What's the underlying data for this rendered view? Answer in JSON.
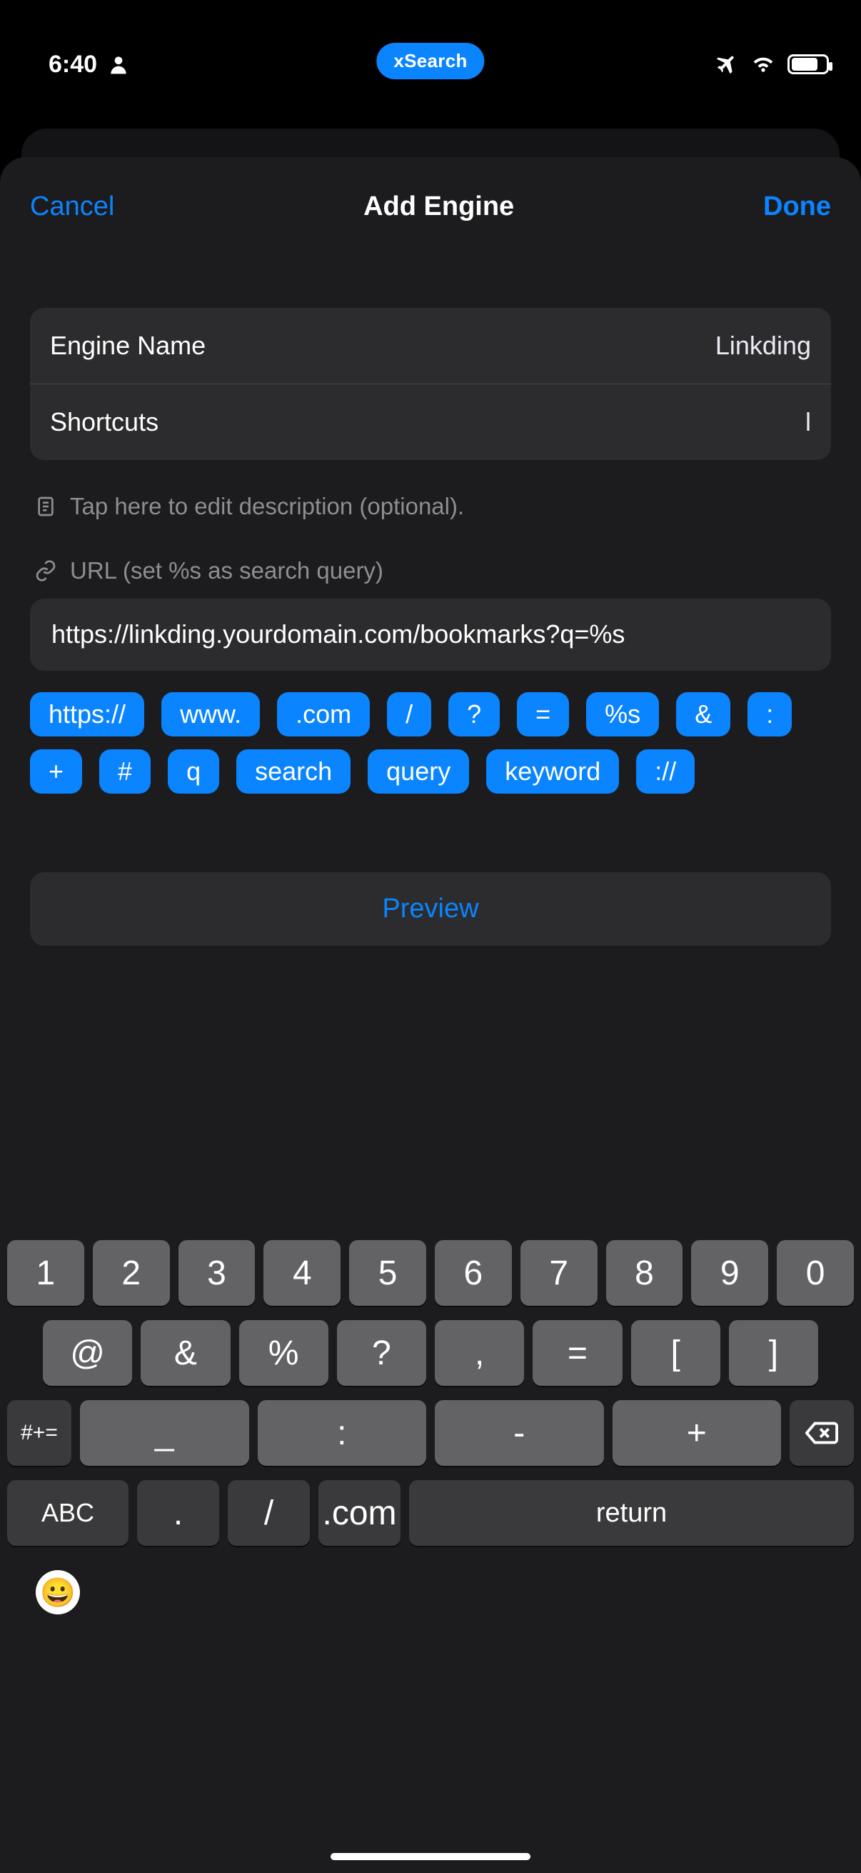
{
  "status": {
    "time": "6:40"
  },
  "pill": {
    "label": "xSearch"
  },
  "nav": {
    "cancel": "Cancel",
    "title": "Add Engine",
    "done": "Done"
  },
  "engine": {
    "name_label": "Engine Name",
    "name_value": "Linkding",
    "shortcut_label": "Shortcuts",
    "shortcut_value": "l",
    "description_hint": "Tap here to edit description (optional).",
    "url_header": "URL (set %s as search query)",
    "url_value": "https://linkding.yourdomain.com/bookmarks?q=%s"
  },
  "url_chips": [
    "https://",
    "www.",
    ".com",
    "/",
    "?",
    "=",
    "%s",
    "&",
    ":",
    "+",
    "#",
    "q",
    "search",
    "query",
    "keyword",
    "://"
  ],
  "preview": {
    "label": "Preview"
  },
  "keyboard": {
    "row1": [
      "1",
      "2",
      "3",
      "4",
      "5",
      "6",
      "7",
      "8",
      "9",
      "0"
    ],
    "row2": [
      "@",
      "&",
      "%",
      "?",
      ",",
      "=",
      "[",
      "]"
    ],
    "row3_mod": "#+=",
    "row3_syms": [
      "_",
      ":",
      "-",
      "+"
    ],
    "row4_abc": "ABC",
    "row4_dot": ".",
    "row4_slash": "/",
    "row4_com": ".com",
    "row4_return": "return"
  }
}
